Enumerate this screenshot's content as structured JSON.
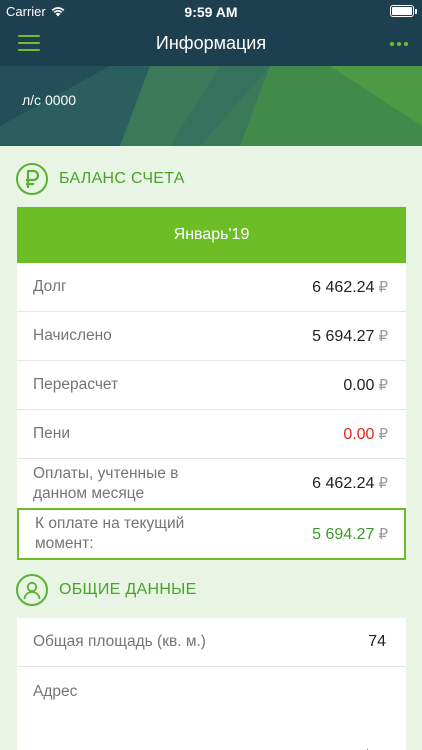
{
  "status_bar": {
    "carrier": "Carrier",
    "time": "9:59 AM",
    "battery_level": 1.0
  },
  "nav": {
    "title": "Информация",
    "menu_icon": "hamburger-icon",
    "more_icon": "more-dots-icon",
    "accent": "#6fc02a",
    "background": "#1d3f50"
  },
  "account": {
    "label": "л/с",
    "number": "0000"
  },
  "balance": {
    "section_title": "БАЛАНС СЧЕТА",
    "section_icon": "ruble-icon",
    "month": "Январь'19",
    "rows": [
      {
        "label": "Долг",
        "value": "6 462.24",
        "currency": "₽"
      },
      {
        "label": "Начислено",
        "value": "5 694.27",
        "currency": "₽"
      },
      {
        "label": "Перерасчет",
        "value": "0.00",
        "currency": "₽"
      },
      {
        "label": "Пени",
        "value": "0.00",
        "currency": "₽"
      },
      {
        "label": "Оплаты, учтенные в данном месяце",
        "value": "6 462.24",
        "currency": "₽"
      }
    ],
    "pay_now": {
      "label": "К оплате на текущий момент:",
      "value": "5 694.27",
      "currency": "₽"
    }
  },
  "general": {
    "section_title": "ОБЩИЕ ДАННЫЕ",
    "section_icon": "user-icon",
    "area_label": "Общая площадь (кв. м.)",
    "area_value": "74",
    "address_label": "Адрес",
    "address_value": ""
  },
  "colors": {
    "green": "#6cbd26",
    "pale_background": "#e8f5e4",
    "debt_red": "#e2231a"
  }
}
